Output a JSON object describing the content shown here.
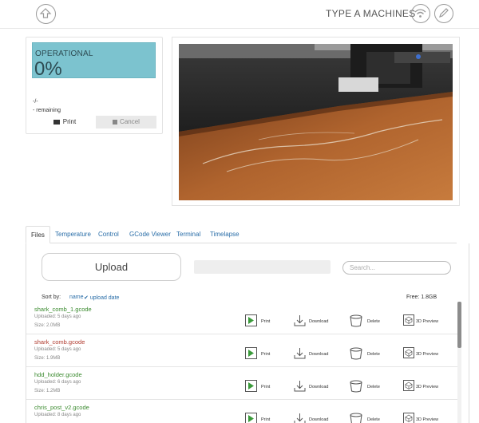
{
  "header": {
    "brand": "TYPE A MACHINES",
    "icons": [
      "upload-circle-icon",
      "wifi-icon",
      "pencil-icon"
    ]
  },
  "status": {
    "state": "OPERATIONAL",
    "progress_text": "0%",
    "progress": 0,
    "time": "-/-",
    "remaining": "- remaining",
    "print_label": "Print",
    "cancel_label": "Cancel",
    "accent_color": "#7cc3cf"
  },
  "tabs": [
    {
      "label": "Files",
      "active": true
    },
    {
      "label": "Temperature"
    },
    {
      "label": "Control"
    },
    {
      "label": "GCode Viewer"
    },
    {
      "label": "Terminal"
    },
    {
      "label": "Timelapse"
    }
  ],
  "files": {
    "upload_label": "Upload",
    "search_placeholder": "Search...",
    "sort_label": "Sort by:",
    "sort_name": "name",
    "sort_upload": "upload date",
    "free_space": "Free: 1.8GB",
    "actions": {
      "print": "Print",
      "download": "Download",
      "delete": "Delete",
      "preview": "3D Preview"
    },
    "items": [
      {
        "name": "shark_comb_1.gcode",
        "uploaded": "Uploaded: 5 days ago",
        "size": "Size: 2.0MB",
        "color": "green"
      },
      {
        "name": "shark_comb.gcode",
        "uploaded": "Uploaded: 5 days ago",
        "size": "Size: 1.9MB",
        "color": "red"
      },
      {
        "name": "hdd_holder.gcode",
        "uploaded": "Uploaded: 6 days ago",
        "size": "Size: 1.2MB",
        "color": "green"
      },
      {
        "name": "chris_post_v2.gcode",
        "uploaded": "Uploaded: 8 days ago",
        "size": "",
        "color": "green"
      }
    ]
  }
}
